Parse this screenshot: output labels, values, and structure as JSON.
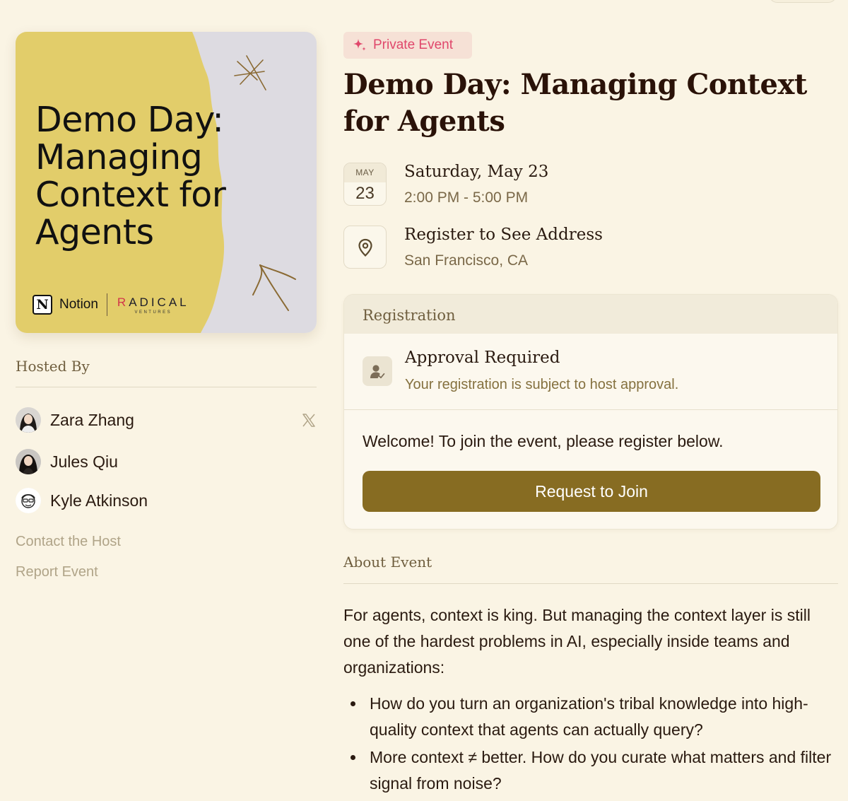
{
  "cover": {
    "title": "Demo Day: Managing Context for Agents",
    "logos": {
      "notion": "Notion",
      "radical": "RADICAL",
      "radical_sub": "VENTURES"
    },
    "colors": {
      "yellow": "#e2cd6a",
      "grey": "#dddbe1"
    }
  },
  "hosts": {
    "label": "Hosted By",
    "items": [
      {
        "name": "Zara Zhang",
        "social": "x-icon"
      },
      {
        "name": "Jules Qiu"
      },
      {
        "name": "Kyle Atkinson"
      }
    ]
  },
  "links": {
    "contact": "Contact the Host",
    "report": "Report Event"
  },
  "event": {
    "badge": "Private Event",
    "title": "Demo Day: Managing Context for Agents",
    "date": {
      "month": "MAY",
      "day": "23",
      "full": "Saturday, May 23",
      "time": "2:00 PM - 5:00 PM"
    },
    "location": {
      "title": "Register to See Address",
      "city": "San Francisco, CA"
    }
  },
  "registration": {
    "header": "Registration",
    "approval_title": "Approval Required",
    "approval_sub": "Your registration is subject to host approval.",
    "welcome": "Welcome! To join the event, please register below.",
    "button": "Request to Join",
    "button_color": "#876c22"
  },
  "about": {
    "label": "About Event",
    "intro": "For agents, context is king. But managing the context layer is still one of the hardest problems in AI, especially inside teams and organizations:",
    "bullets": [
      "How do you turn an organization's tribal knowledge into high-quality context that agents can actually query?",
      "More context ≠ better. How do you curate what matters and filter signal from noise?"
    ]
  },
  "accent": {
    "badge_text": "#e0476b",
    "badge_bg": "#f6e1d6"
  }
}
